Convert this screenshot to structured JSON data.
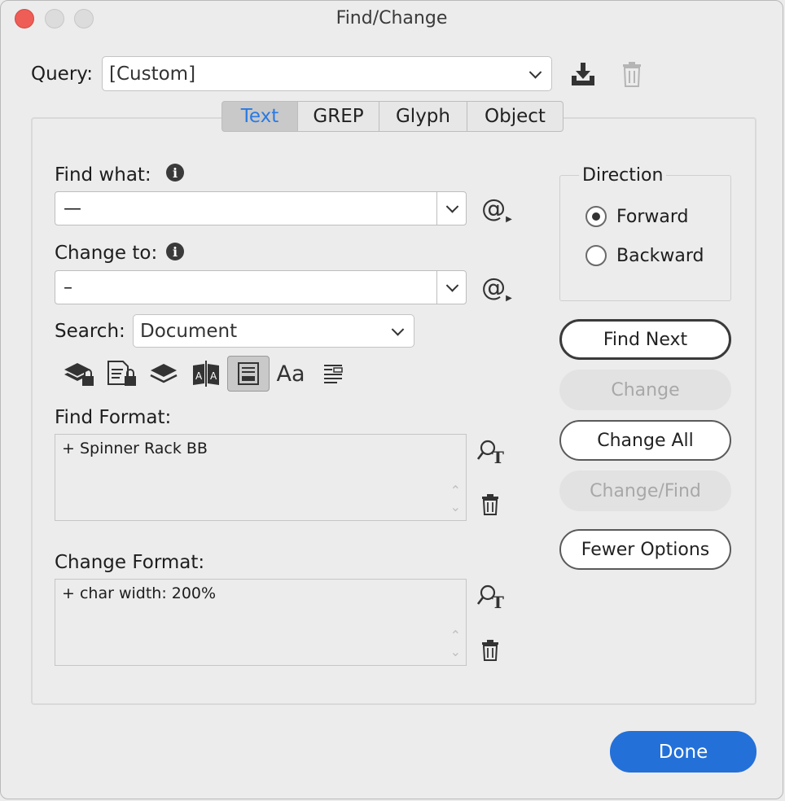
{
  "window": {
    "title": "Find/Change"
  },
  "query": {
    "label": "Query:",
    "value": "[Custom]"
  },
  "tabs": [
    {
      "label": "Text",
      "active": true
    },
    {
      "label": "GREP",
      "active": false
    },
    {
      "label": "Glyph",
      "active": false
    },
    {
      "label": "Object",
      "active": false
    }
  ],
  "find": {
    "label": "Find what:",
    "value": "—"
  },
  "change": {
    "label": "Change to:",
    "value": "–"
  },
  "search": {
    "label": "Search:",
    "value": "Document"
  },
  "find_format": {
    "label": "Find Format:",
    "value": "+ Spinner Rack BB"
  },
  "change_format": {
    "label": "Change Format:",
    "value": "+ char width: 200%"
  },
  "direction": {
    "label": "Direction",
    "forward": "Forward",
    "backward": "Backward",
    "selected": "Forward"
  },
  "buttons": {
    "find_next": "Find Next",
    "change": "Change",
    "change_all": "Change All",
    "change_find": "Change/Find",
    "fewer_options": "Fewer Options",
    "done": "Done"
  },
  "colors": {
    "accent": "#2370d8",
    "tab_active_text": "#2a7ae2",
    "close": "#ee5e57"
  },
  "icons": {
    "save_query": "download-icon",
    "delete_query": "trash-icon",
    "special_chars": "at-sign-menu-icon",
    "tools": [
      "locked-layers-icon",
      "locked-stories-icon",
      "hidden-layers-icon",
      "master-pages-icon",
      "footnotes-icon",
      "case-sensitive-icon",
      "whole-word-icon"
    ]
  }
}
